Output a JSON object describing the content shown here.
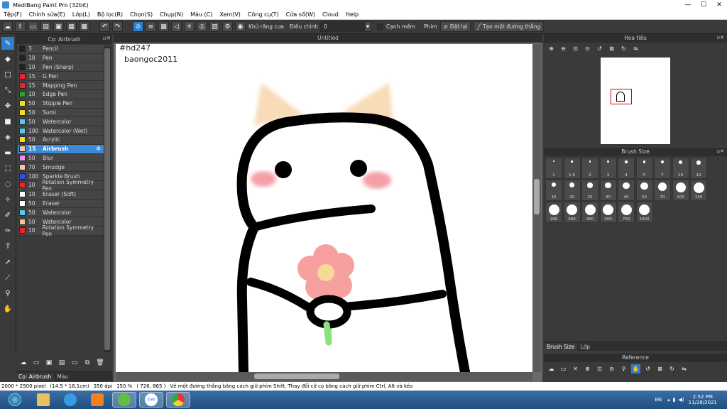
{
  "window": {
    "title": "MediBang Paint Pro (32bit)",
    "minimize": "—",
    "maximize": "☐",
    "close": "✕"
  },
  "menu": [
    "Tệp(F)",
    "Chỉnh sửa(E)",
    "Lớp(L)",
    "Bộ lọc(R)",
    "Chọn(S)",
    "Chụp(N)",
    "Màu (C)",
    "Xem(V)",
    "Công cụ(T)",
    "Cửa sổ(W)",
    "Cloud",
    "Help"
  ],
  "toolbar": {
    "antialias_label": "Khử răng cưa",
    "adjust_label": "Điều chỉnh",
    "adjust_value": "0",
    "edge_label": "Cạnh mềm",
    "key_label": "Phím",
    "reset_label": "Đặt lại",
    "line_label": "Tạo một đường thẳng"
  },
  "brush_panel": {
    "title": "Cọ: Airbrush",
    "items": [
      {
        "size": "3",
        "name": "Pencil",
        "color": "#222222"
      },
      {
        "size": "10",
        "name": "Pen",
        "color": "#222222"
      },
      {
        "size": "10",
        "name": "Pen (Sharp)",
        "color": "#222222"
      },
      {
        "size": "15",
        "name": "G Pen",
        "color": "#e8262b"
      },
      {
        "size": "15",
        "name": "Mapping Pen",
        "color": "#e8262b"
      },
      {
        "size": "10",
        "name": "Edge Pen",
        "color": "#2aa52a"
      },
      {
        "size": "50",
        "name": "Stipple Pen",
        "color": "#f0e020"
      },
      {
        "size": "50",
        "name": "Sumi",
        "color": "#f0e020"
      },
      {
        "size": "50",
        "name": "Watercolor",
        "color": "#5ac8f0"
      },
      {
        "size": "100",
        "name": "Watercolor (Wet)",
        "color": "#5ac8f0"
      },
      {
        "size": "50",
        "name": "Acrylic",
        "color": "#f0e020"
      },
      {
        "size": "15",
        "name": "Airbrush",
        "color": "#f5c6a0"
      },
      {
        "size": "50",
        "name": "Blur",
        "color": "#f090e8"
      },
      {
        "size": "70",
        "name": "Smudge",
        "color": "#f5c6a0"
      },
      {
        "size": "100",
        "name": "Sparkle Brush",
        "color": "#2b50e0"
      },
      {
        "size": "10",
        "name": "Rotation Symmetry Pen",
        "color": "#e8262b"
      },
      {
        "size": "10",
        "name": "Eraser (Soft)",
        "color": "#ffffff"
      },
      {
        "size": "50",
        "name": "Eraser",
        "color": "#ffffff"
      },
      {
        "size": "50",
        "name": "Watercolor",
        "color": "#5ac8f0"
      },
      {
        "size": "50",
        "name": "Watercolor",
        "color": "#f5c6a0"
      },
      {
        "size": "10",
        "name": "Rotation Symmetry Pen",
        "color": "#e8262b"
      }
    ],
    "tabs": [
      "Cọ: Airbrush",
      "Màu"
    ]
  },
  "canvas": {
    "title": "Untitled",
    "text1": "#hd247",
    "text2": "baongoc2011"
  },
  "navigator": {
    "title": "Hoa tiêu"
  },
  "brush_size": {
    "title": "Brush Size",
    "sizes": [
      "1",
      "1.5",
      "2",
      "3",
      "4",
      "5",
      "7",
      "10",
      "12",
      "15",
      "20",
      "25",
      "30",
      "40",
      "50",
      "70",
      "100",
      "150",
      "200",
      "300",
      "400",
      "500",
      "700",
      "1000"
    ],
    "tabs": [
      "Brush Size",
      "Lớp"
    ]
  },
  "reference": {
    "title": "Reference"
  },
  "status": {
    "dimensions": "2000 * 2500 pixel",
    "physical": "(14.5 * 18.1cm)",
    "dpi": "350 dpi",
    "zoom": "150 %",
    "coords": "( 726, 865 )",
    "hint": "Vẽ một đường thẳng bằng cách giữ phím Shift, Thay đổi cỡ cọ bằng cách giữ phím Ctrl, Alt và kéo"
  },
  "taskbar": {
    "lang": "EN",
    "time": "2:52 PM",
    "date": "11/28/2021",
    "zalo": "Zalo"
  }
}
